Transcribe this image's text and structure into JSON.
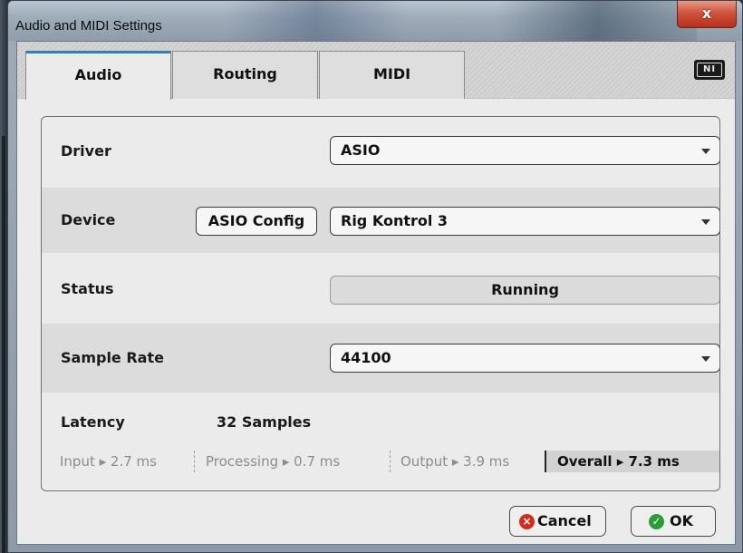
{
  "window": {
    "title": "Audio and MIDI Settings",
    "close_glyph": "x"
  },
  "tabs": [
    {
      "label": "Audio",
      "active": true
    },
    {
      "label": "Routing",
      "active": false
    },
    {
      "label": "MIDI",
      "active": false
    }
  ],
  "logo": {
    "text": "NI"
  },
  "settings": {
    "driver": {
      "label": "Driver",
      "value": "ASIO"
    },
    "device": {
      "label": "Device",
      "config_button": "ASIO Config",
      "value": "Rig Kontrol 3"
    },
    "status": {
      "label": "Status",
      "value": "Running"
    },
    "sample_rate": {
      "label": "Sample Rate",
      "value": "44100"
    },
    "latency": {
      "label": "Latency",
      "value": "32 Samples",
      "input": "Input ▸ 2.7 ms",
      "processing": "Processing  ▸ 0.7 ms",
      "output": "Output ▸ 3.9 ms",
      "overall": "Overall  ▸ 7.3 ms"
    }
  },
  "buttons": {
    "cancel": "Cancel",
    "ok": "OK"
  },
  "colors": {
    "accent_tab": "#2f7fb8",
    "cancel_icon": "#d42b1e",
    "ok_icon": "#2f9a3a",
    "close_button": "#c8412b"
  }
}
